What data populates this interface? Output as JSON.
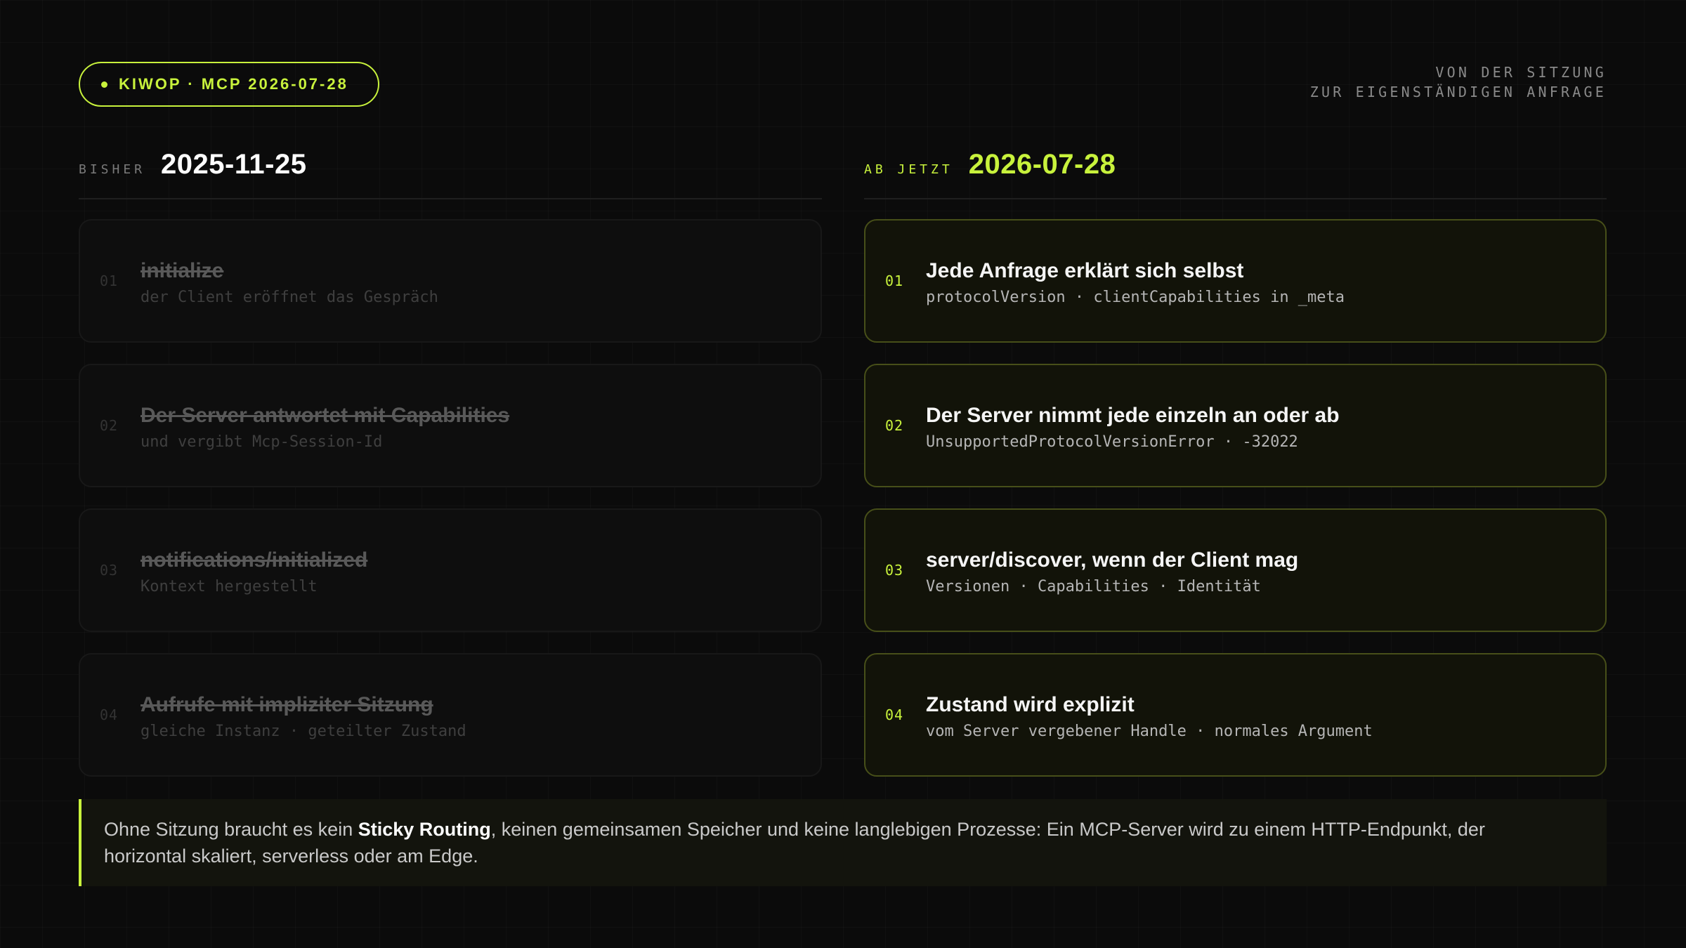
{
  "header": {
    "badge": "KIWOP · MCP 2026-07-28",
    "tagline_line1": "VON DER SITZUNG",
    "tagline_line2": "ZUR EIGENSTÄNDIGEN ANFRAGE"
  },
  "left": {
    "label": "BISHER",
    "version": "2025-11-25",
    "items": [
      {
        "num": "01",
        "title": "initialize",
        "sub": "der Client eröffnet das Gespräch"
      },
      {
        "num": "02",
        "title": "Der Server antwortet mit Capabilities",
        "sub": "und vergibt Mcp-Session-Id"
      },
      {
        "num": "03",
        "title": "notifications/initialized",
        "sub": "Kontext hergestellt"
      },
      {
        "num": "04",
        "title": "Aufrufe mit impliziter Sitzung",
        "sub": "gleiche Instanz · geteilter Zustand"
      }
    ]
  },
  "right": {
    "label": "AB JETZT",
    "version": "2026-07-28",
    "items": [
      {
        "num": "01",
        "title": "Jede Anfrage erklärt sich selbst",
        "sub": "protocolVersion · clientCapabilities in _meta"
      },
      {
        "num": "02",
        "title": "Der Server nimmt jede einzeln an oder ab",
        "sub": "UnsupportedProtocolVersionError · -32022"
      },
      {
        "num": "03",
        "title": "server/discover, wenn der Client mag",
        "sub": "Versionen · Capabilities · Identität"
      },
      {
        "num": "04",
        "title": "Zustand wird explizit",
        "sub": "vom Server vergebener Handle · normales Argument"
      }
    ]
  },
  "note": {
    "before": "Ohne Sitzung braucht es kein ",
    "emphasis": "Sticky Routing",
    "after": ", keinen gemeinsamen Speicher und keine langlebigen Prozesse: Ein MCP-Server wird zu einem HTTP-Endpunkt, der horizontal skaliert, serverless oder am Edge."
  },
  "colors": {
    "accent": "#c8f23c",
    "background": "#0b0b0b"
  }
}
